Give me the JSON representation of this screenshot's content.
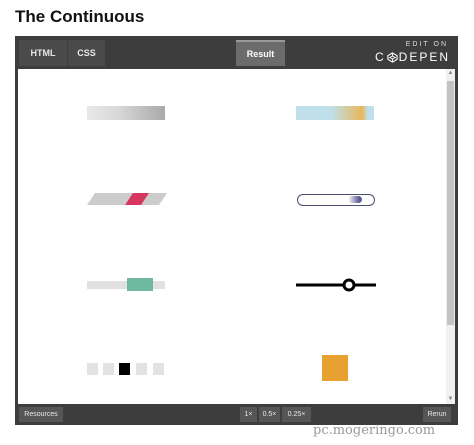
{
  "page": {
    "title": "The Continuous"
  },
  "tabs": {
    "html": "HTML",
    "css": "CSS",
    "result": "Result"
  },
  "brand": {
    "small": "EDIT ON",
    "big_left": "C",
    "big_right": "DEPEN"
  },
  "bottom": {
    "resources": "Resources",
    "zoom_1": "1×",
    "zoom_05": "0.5×",
    "zoom_025": "0.25×",
    "rerun": "Rerun"
  },
  "watermark": "pc.mogeringo.com",
  "colors": {
    "embed_bg": "#3d3d3e",
    "loader_teal": "#6fb9a0",
    "loader_pink": "#d6375f",
    "loader_orange": "#e8a030",
    "loader_navy": "#4b4e6e"
  },
  "loaders": [
    {
      "name": "gray-gradient-bar"
    },
    {
      "name": "blue-orange-gradient-bar"
    },
    {
      "name": "skewed-stripe-bar"
    },
    {
      "name": "pill-comet"
    },
    {
      "name": "slider-knob"
    },
    {
      "name": "line-ring"
    },
    {
      "name": "stepping-squares",
      "active_index": 2,
      "count": 5
    },
    {
      "name": "orange-square"
    }
  ]
}
